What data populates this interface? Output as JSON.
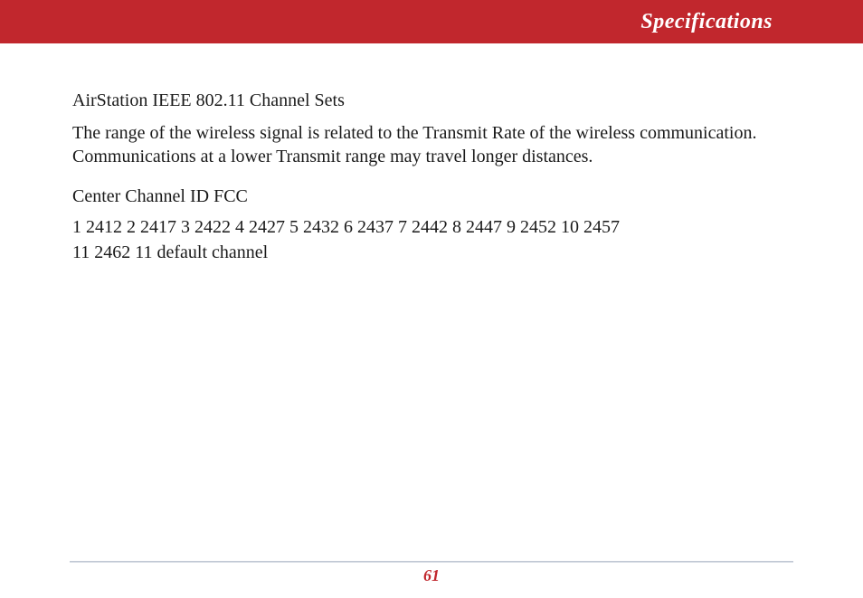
{
  "header": {
    "title": "Specifications"
  },
  "content": {
    "section_title": "AirStation IEEE 802.11 Channel Sets",
    "paragraph": "The range of the wireless signal is related to the Transmit Rate of the wireless communication. Communications at a lower Transmit range may travel longer distances.",
    "sub_heading": "Center Channel ID FCC",
    "channels_line1": "1 2412  2 2417  3 2422  4 2427  5 2432  6 2437  7 2442  8 2447  9 2452  10 2457",
    "channels_line2": "11 2462 11  default channel"
  },
  "footer": {
    "page_number": "61"
  }
}
